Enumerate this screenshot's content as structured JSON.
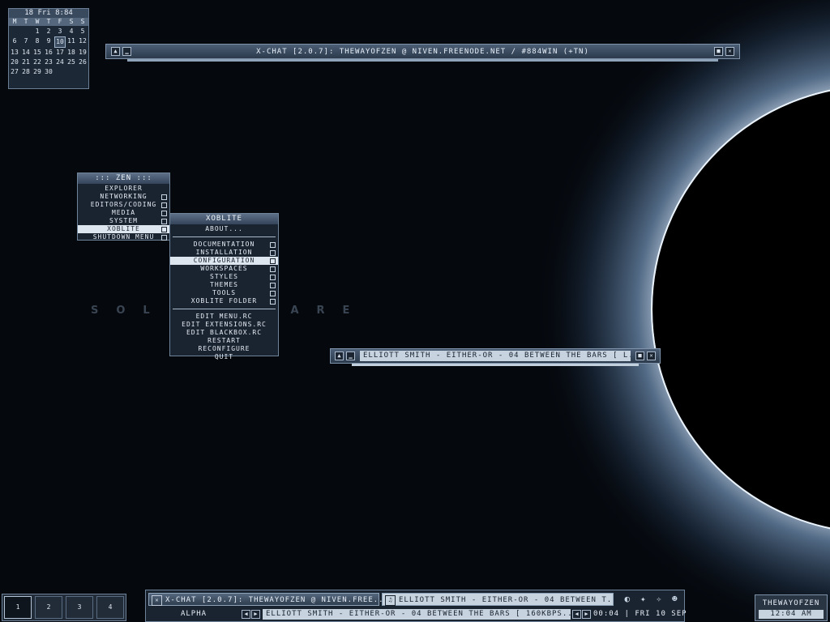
{
  "wallpaper": {
    "watermark": "SOL  ARFLARE"
  },
  "calendar": {
    "header": "18 Fri 8:84",
    "dow": [
      "M",
      "T",
      "W",
      "T",
      "F",
      "S",
      "S"
    ],
    "days": [
      "",
      "",
      "1",
      "2",
      "3",
      "4",
      "5",
      "6",
      "7",
      "8",
      "9",
      "10",
      "11",
      "12",
      "13",
      "14",
      "15",
      "16",
      "17",
      "18",
      "19",
      "20",
      "21",
      "22",
      "23",
      "24",
      "25",
      "26",
      "27",
      "28",
      "29",
      "30",
      "",
      "",
      "",
      "",
      ""
    ],
    "selected": "10"
  },
  "xchat": {
    "title": "X-Chat [2.0.7]: thewayofzen @ niven.freenode.net / #884win (+tn)"
  },
  "zen_menu": {
    "title": "::: ZEN :::",
    "items": [
      {
        "label": "Explorer",
        "sub": false
      },
      {
        "label": "Networking",
        "sub": true
      },
      {
        "label": "Editors/Coding",
        "sub": true
      },
      {
        "label": "Media",
        "sub": true
      },
      {
        "label": "System",
        "sub": true
      },
      {
        "label": "xoblite",
        "sub": true,
        "active": true
      },
      {
        "label": "Shutdown Menu",
        "sub": true
      }
    ]
  },
  "xoblite_menu": {
    "title": "xoblite",
    "about": "About...",
    "items": [
      {
        "label": "Documentation"
      },
      {
        "label": "Installation"
      },
      {
        "label": "Configuration",
        "active": true
      },
      {
        "label": "Workspaces"
      },
      {
        "label": "Styles"
      },
      {
        "label": "Themes"
      },
      {
        "label": "Tools"
      },
      {
        "label": "xoblite Folder"
      }
    ],
    "actions": [
      "Edit Menu.rc",
      "Edit Extensions.rc",
      "Edit Blackbox.rc",
      "Restart",
      "Reconfigure",
      "Quit"
    ]
  },
  "player": {
    "title": "Elliott Smith - Either-Or - 04 Between the Bars  [ l..."
  },
  "workspaces": [
    "1",
    "2",
    "3",
    "4"
  ],
  "taskbar": {
    "task1": "X-Chat [2.0.7]: thewayofzen @ niven.free...",
    "task2": "Elliott Smith - Either-Or - 04 Between t...",
    "workspace_label": "alpha",
    "now_playing": "Elliott Smith - Either-Or - 04 Between the Bars  [ 160kbps...",
    "status": "00:04 | Fri 10 Sep"
  },
  "clock": {
    "user": "thewayofzen",
    "time": "12:04 AM"
  }
}
